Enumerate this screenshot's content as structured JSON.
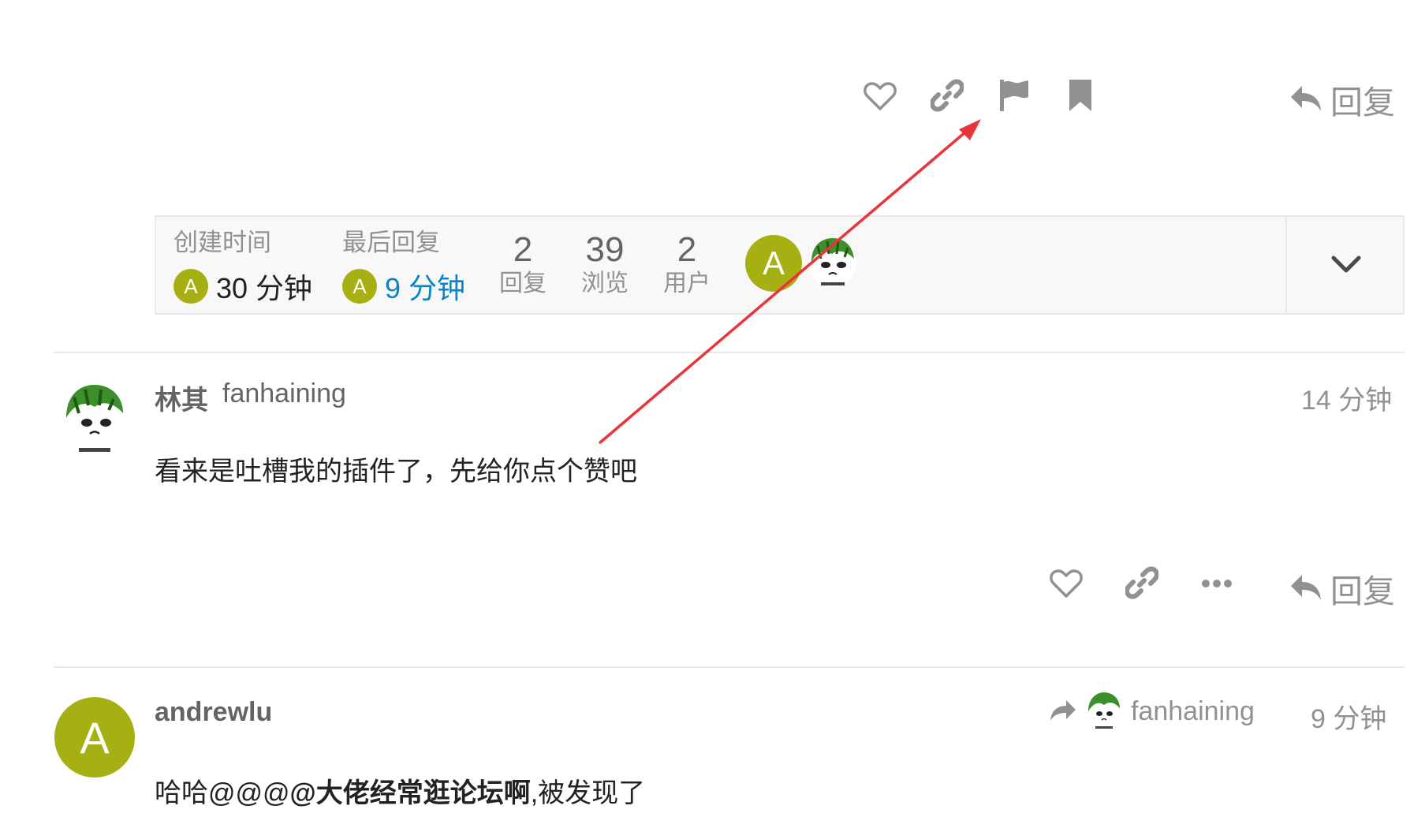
{
  "post1_actions": {
    "like_icon": "heart-outline",
    "link_icon": "link",
    "flag_icon": "flag",
    "bookmark_icon": "bookmark",
    "reply_label": "回复"
  },
  "topic_map": {
    "created": {
      "label": "创建时间",
      "avatar_letter": "A",
      "time": "30 分钟"
    },
    "last_reply": {
      "label": "最后回复",
      "avatar_letter": "A",
      "time": "9 分钟"
    },
    "stats": [
      {
        "num": "2",
        "label": "回复"
      },
      {
        "num": "39",
        "label": "浏览"
      },
      {
        "num": "2",
        "label": "用户"
      }
    ],
    "participant_letter": "A",
    "expand_icon": "chevron-down"
  },
  "post2": {
    "name": "林其",
    "username": "fanhaining",
    "date": "14 分钟",
    "body": "看来是吐槽我的插件了，先给你点个赞吧",
    "reply_label": "回复"
  },
  "post3": {
    "avatar_letter": "A",
    "username": "andrewlu",
    "reply_to_user": "fanhaining",
    "date": "9 分钟",
    "body_prefix": "哈哈@@@",
    "body_bold": "@大佬经常逛论坛啊",
    "body_suffix": ",被发现了"
  },
  "colors": {
    "avatar_green": "#a6b012",
    "icon_gray": "#919191",
    "link_blue": "#0a84c8",
    "annotation_red": "#e8343a"
  }
}
